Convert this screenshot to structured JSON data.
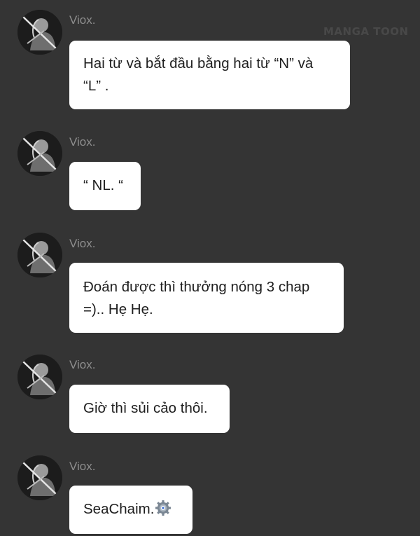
{
  "watermark": "MANGA TOON",
  "messages": [
    {
      "sender": "Viox.",
      "text": "Hai từ và bắt đầu bằng hai từ “N” và\n“L” ."
    },
    {
      "sender": "Viox.",
      "text": "“ NL. “"
    },
    {
      "sender": "Viox.",
      "text": "Đoán được thì thưởng nóng 3 chap\n=).. Hẹ Hẹ."
    },
    {
      "sender": "Viox.",
      "text": "Giờ thì sủi cảo thôi."
    },
    {
      "sender": "Viox.",
      "text": "SeaChaim.",
      "emoji": "gear-emoji"
    }
  ],
  "colors": {
    "background": "#343434",
    "bubble": "#ffffff",
    "sender": "#8e8e8e"
  }
}
